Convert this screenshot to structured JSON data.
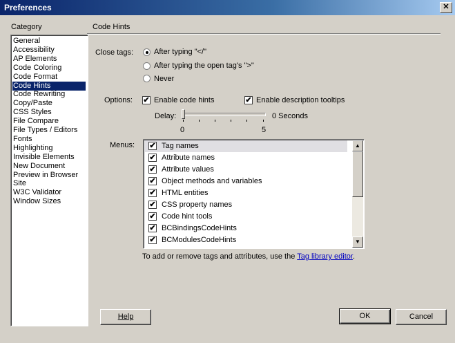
{
  "window": {
    "title": "Preferences",
    "close_glyph": "✕"
  },
  "category": {
    "label": "Category",
    "items": [
      "General",
      "Accessibility",
      "AP Elements",
      "Code Coloring",
      "Code Format",
      "Code Hints",
      "Code Rewriting",
      "Copy/Paste",
      "CSS Styles",
      "File Compare",
      "File Types / Editors",
      "Fonts",
      "Highlighting",
      "Invisible Elements",
      "New Document",
      "Preview in Browser",
      "Site",
      "W3C Validator",
      "Window Sizes"
    ],
    "selected": "Code Hints"
  },
  "panel": {
    "title": "Code Hints"
  },
  "close_tags": {
    "label": "Close tags:",
    "options": [
      "After typing \"</\"",
      "After typing the open tag's \">\"",
      "Never"
    ],
    "selected_index": 0
  },
  "options": {
    "label": "Options:",
    "enable_code_hints": {
      "label": "Enable code hints",
      "checked": true
    },
    "enable_description_tooltips": {
      "label": "Enable description tooltips",
      "checked": true
    }
  },
  "delay": {
    "label": "Delay:",
    "value_text": "0 Seconds",
    "min_label": "0",
    "max_label": "5",
    "value": 0
  },
  "menus": {
    "label": "Menus:",
    "items": [
      {
        "label": "Tag names",
        "checked": true
      },
      {
        "label": "Attribute names",
        "checked": true
      },
      {
        "label": "Attribute values",
        "checked": true
      },
      {
        "label": "Object methods and variables",
        "checked": true
      },
      {
        "label": "HTML entities",
        "checked": true
      },
      {
        "label": "CSS property names",
        "checked": true
      },
      {
        "label": "Code hint tools",
        "checked": true
      },
      {
        "label": "BCBindingsCodeHints",
        "checked": true
      },
      {
        "label": "BCModulesCodeHints",
        "checked": true
      }
    ],
    "selected_index": 0
  },
  "footnote": {
    "text": "To add or remove tags and attributes, use the ",
    "link": "Tag library editor",
    "suffix": "."
  },
  "buttons": {
    "help": "Help",
    "ok": "OK",
    "cancel": "Cancel"
  },
  "icons": {
    "check": "✔",
    "scroll_up": "▲",
    "scroll_down": "▼"
  }
}
